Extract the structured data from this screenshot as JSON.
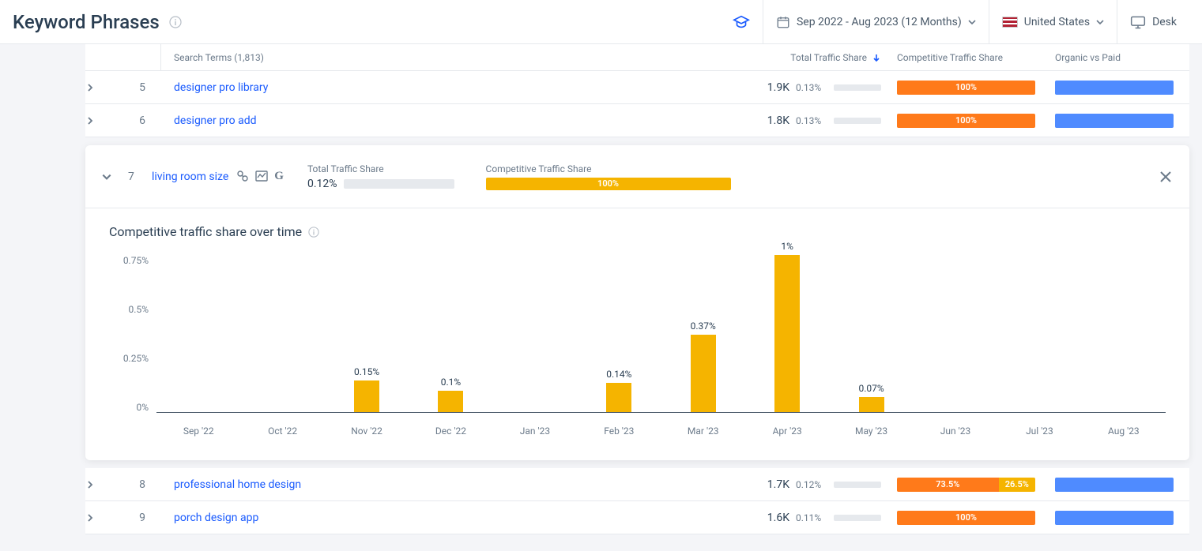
{
  "header": {
    "title": "Keyword Phrases",
    "date_range": "Sep 2022 - Aug 2023 (12 Months)",
    "country": "United States",
    "device": "Desk"
  },
  "table": {
    "headers": {
      "terms": "Search Terms (1,813)",
      "traffic": "Total Traffic Share",
      "comp": "Competitive Traffic Share",
      "ovp": "Organic vs Paid"
    },
    "rows_top": [
      {
        "idx": "5",
        "term": "designer pro library",
        "traffic": "1.9K",
        "share": "0.13%",
        "comp_segments": [
          {
            "pct": 100,
            "label": "100%",
            "color": "#ff7a1a"
          }
        ]
      },
      {
        "idx": "6",
        "term": "designer pro add",
        "traffic": "1.8K",
        "share": "0.13%",
        "comp_segments": [
          {
            "pct": 100,
            "label": "100%",
            "color": "#ff7a1a"
          }
        ]
      }
    ],
    "rows_bottom": [
      {
        "idx": "8",
        "term": "professional home design",
        "traffic": "1.7K",
        "share": "0.12%",
        "comp_segments": [
          {
            "pct": 73.5,
            "label": "73.5%",
            "color": "#ff7a1a"
          },
          {
            "pct": 26.5,
            "label": "26.5%",
            "color": "#f5b400"
          }
        ]
      },
      {
        "idx": "9",
        "term": "porch design app",
        "traffic": "1.6K",
        "share": "0.11%",
        "comp_segments": [
          {
            "pct": 100,
            "label": "100%",
            "color": "#ff7a1a"
          }
        ]
      }
    ]
  },
  "expanded": {
    "idx": "7",
    "term": "living room size",
    "tts_label": "Total Traffic Share",
    "tts_value": "0.12%",
    "cts_label": "Competitive Traffic Share",
    "cts_value": "100%",
    "chart_title": "Competitive traffic share over time"
  },
  "chart_data": {
    "type": "bar",
    "categories": [
      "Sep '22",
      "Oct '22",
      "Nov '22",
      "Dec '22",
      "Jan '23",
      "Feb '23",
      "Mar '23",
      "Apr '23",
      "May '23",
      "Jun '23",
      "Jul '23",
      "Aug '23"
    ],
    "values": [
      0,
      0,
      0.15,
      0.1,
      0,
      0.14,
      0.37,
      1.0,
      0.07,
      0,
      0,
      0
    ],
    "labels": [
      "",
      "",
      "0.15%",
      "0.1%",
      "",
      "0.14%",
      "0.37%",
      "1%",
      "0.07%",
      "",
      "",
      ""
    ],
    "y_ticks": [
      "0.75%",
      "0.5%",
      "0.25%",
      "0%"
    ],
    "ylim": [
      0,
      0.75
    ],
    "title": "Competitive traffic share over time",
    "xlabel": "",
    "ylabel": ""
  }
}
